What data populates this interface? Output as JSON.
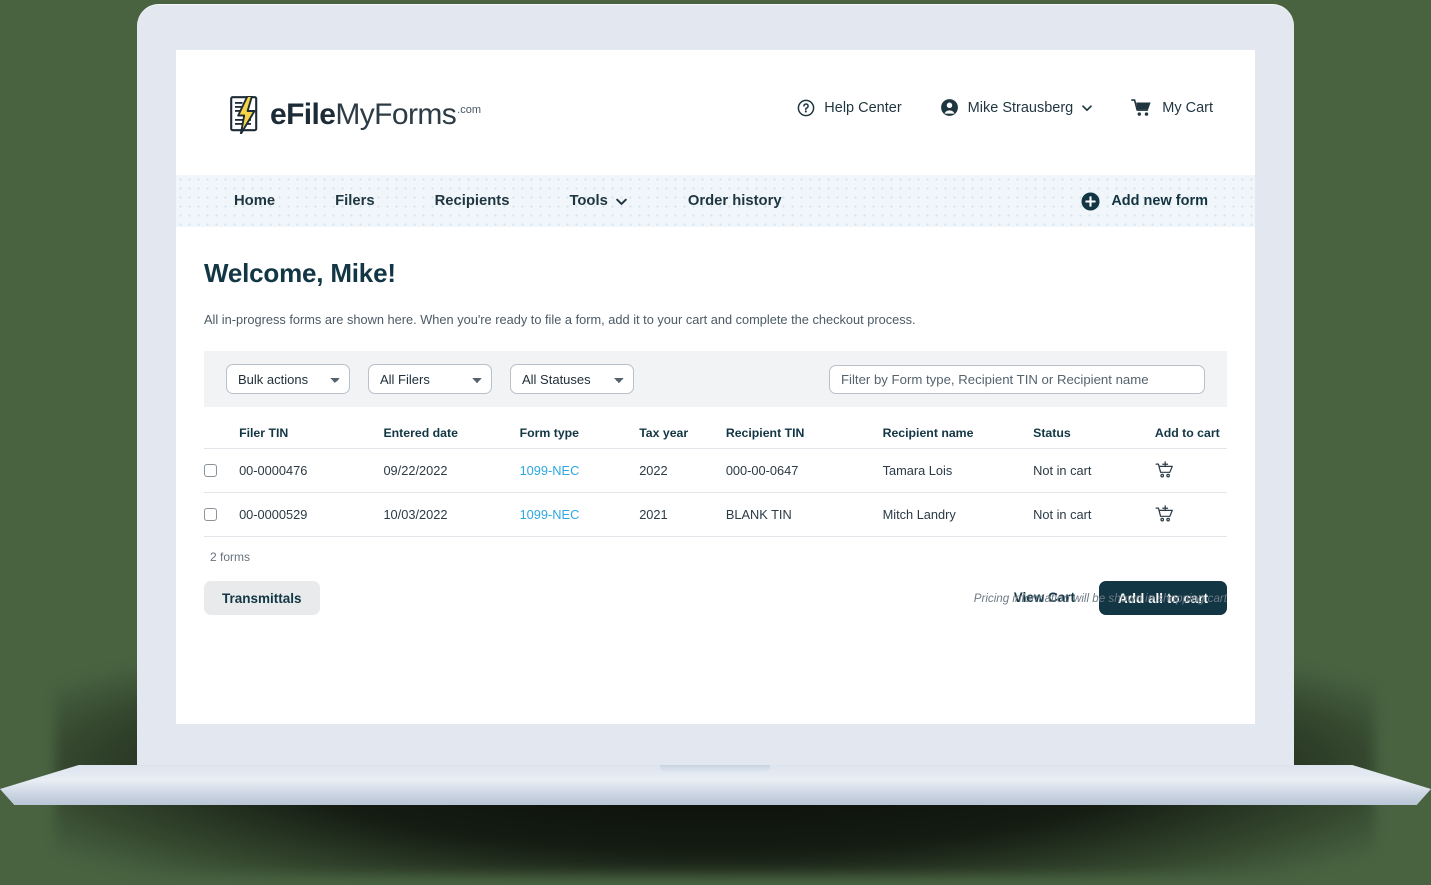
{
  "brand": {
    "name_bold": "eFile",
    "name_light": "MyForms",
    "tld": ".com",
    "mark_icon": "document-lightning-icon"
  },
  "header": {
    "actions": [
      {
        "label": "Help Center",
        "icon": "question-circle-icon"
      },
      {
        "label": "Mike Strausberg",
        "icon": "user-circle-icon",
        "caret": "chevron-down-icon"
      },
      {
        "label": "My Cart",
        "icon": "shopping-cart-icon"
      }
    ]
  },
  "nav": {
    "items": [
      {
        "label": "Home",
        "has_caret": false
      },
      {
        "label": "Filers",
        "has_caret": false
      },
      {
        "label": "Recipients",
        "has_caret": false
      },
      {
        "label": "Tools",
        "has_caret": true
      },
      {
        "label": "Order history",
        "has_caret": false
      }
    ],
    "add_new_form": {
      "label": "Add new form",
      "icon": "plus-circle-icon"
    }
  },
  "page": {
    "title": "Welcome, Mike!",
    "subtitle": "All in-progress forms are shown here. When you're ready to file a form, add it to your cart and complete the checkout process."
  },
  "filters": {
    "bulk_actions": {
      "selected": "Bulk actions",
      "options": [
        "Bulk actions"
      ]
    },
    "filers": {
      "selected": "All Filers",
      "options": [
        "All Filers"
      ]
    },
    "statuses": {
      "selected": "All Statuses",
      "options": [
        "All Statuses"
      ]
    },
    "search": {
      "value": "",
      "placeholder": "Filter by Form type, Recipient TIN or Recipient name"
    }
  },
  "table": {
    "columns": [
      "Filer TIN",
      "Entered date",
      "Form type",
      "Tax year",
      "Recipient TIN",
      "Recipient name",
      "Status",
      "Add to cart"
    ],
    "rows": [
      {
        "filer_tin": "00-0000476",
        "entered_date": "09/22/2022",
        "form_type": "1099-NEC",
        "tax_year": "2022",
        "recipient_tin": "000-00-0647",
        "recipient_name": "Tamara Lois",
        "status": "Not in cart",
        "cart_icon": "cart-plus-icon"
      },
      {
        "filer_tin": "00-0000529",
        "entered_date": "10/03/2022",
        "form_type": "1099-NEC",
        "tax_year": "2021",
        "recipient_tin": "BLANK TIN",
        "recipient_name": "Mitch Landry",
        "status": "Not in cart",
        "cart_icon": "cart-plus-icon"
      }
    ],
    "count_label": "2 forms"
  },
  "footer": {
    "transmittals_label": "Transmittals",
    "view_cart_label": "View Cart",
    "add_all_label": "Add all to cart",
    "pricing_note": "Pricing information will be shown in shopping cart"
  },
  "colors": {
    "background": "#496341",
    "brand_dark": "#123644",
    "link_blue": "#2ea7e0",
    "nav_bg": "#f1f6fa",
    "bolt_yellow": "#f5d547"
  }
}
